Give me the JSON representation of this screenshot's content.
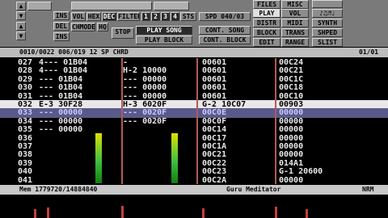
{
  "sample": {
    "ins": "INS",
    "del": "DEL",
    "ins2": "INS"
  },
  "modes": {
    "hex": "HEX",
    "dec": "DEC",
    "filter": "FILTER",
    "sts": "STS",
    "chmode": "CHMODE",
    "hq": "HQ",
    "vol": "VOL"
  },
  "ch_buttons": [
    "1",
    "2",
    "3",
    "4"
  ],
  "transport": {
    "stop": "STOP",
    "play_song": "PLAY SONG",
    "play_block": "PLAY BLOCK",
    "spd": "SPD  040/03",
    "cont_song": "CONT. SONG",
    "cont_block": "CONT. BLOCK"
  },
  "menu": {
    "files": "FILES",
    "misc": "MISC",
    "play": "PLAY",
    "vol": "VOL",
    "distr": "DISTR",
    "midi": "MIDI",
    "synth": "SYNTH",
    "block": "BLOCK",
    "trans": "TRANS",
    "shped": "SHPED",
    "edit": "EDIT",
    "range": "RANGE",
    "slist": "SLIST",
    "sym": "♪♫♬♩"
  },
  "status": {
    "left": "0010/0022  006/019  12  SP  CHRD",
    "page": "01/01"
  },
  "tracker_rows": [
    {
      "n": "027",
      "c1": "4---  01B04",
      "c2": "-",
      "c3": "00601",
      "c4": "00C24",
      "cls": ""
    },
    {
      "n": "028",
      "c1": "4---  01B04",
      "c2": "H-2  10000",
      "c3": "00601",
      "c4": "00C21",
      "cls": ""
    },
    {
      "n": "029",
      "c1": "---  01B04",
      "c2": "---  00000",
      "c3": "00601",
      "c4": "00C1C",
      "cls": ""
    },
    {
      "n": "030",
      "c1": "---  01B04",
      "c2": "---  00000",
      "c3": "00601",
      "c4": "00C18",
      "cls": ""
    },
    {
      "n": "031",
      "c1": "---  01B04",
      "c2": "---  00000",
      "c3": "00601",
      "c4": "00C10",
      "cls": ""
    },
    {
      "n": "032",
      "c1": "E-3  30F28",
      "c2": "H-3  6020F",
      "c3": "G-2  10C07",
      "c4": "00903",
      "cls": "cur"
    },
    {
      "n": "033",
      "c1": "---  00000",
      "c2": "---  0020F",
      "c3": "00C0E",
      "c4": "00000",
      "cls": "dim"
    },
    {
      "n": "034",
      "c1": "---  00000",
      "c2": "---  0020F",
      "c3": "00C0F",
      "c4": "00000",
      "cls": ""
    },
    {
      "n": "035",
      "c1": "---  00000",
      "c2": "",
      "c3": "00C14",
      "c4": "00000",
      "cls": ""
    },
    {
      "n": "036",
      "c1": "",
      "c2": "",
      "c3": "00C17",
      "c4": "00000",
      "cls": ""
    },
    {
      "n": "037",
      "c1": "",
      "c2": "",
      "c3": "00C1A",
      "c4": "00000",
      "cls": ""
    },
    {
      "n": "038",
      "c1": "",
      "c2": "",
      "c3": "00C21",
      "c4": "00000",
      "cls": ""
    },
    {
      "n": "039",
      "c1": "",
      "c2": "",
      "c3": "00C22",
      "c4": "014A1",
      "cls": ""
    },
    {
      "n": "040",
      "c1": "",
      "c2": "",
      "c3": "00C23",
      "c4": "G-1 20600",
      "cls": ""
    },
    {
      "n": "041",
      "c1": "",
      "c2": "",
      "c3": "00C2A",
      "c4": "00000",
      "cls": ""
    }
  ],
  "memory": {
    "text": "Mem  1779720/14884840",
    "song": "Guru Meditator",
    "mode": "NRM"
  },
  "colors": {
    "panel": "#7a7a7a",
    "highlight": "#e8e8e8",
    "cursor_row": "#5a5a8a",
    "vu_green": "#40c040",
    "vu_yellow": "#e0e000",
    "scope": "#c04040"
  }
}
